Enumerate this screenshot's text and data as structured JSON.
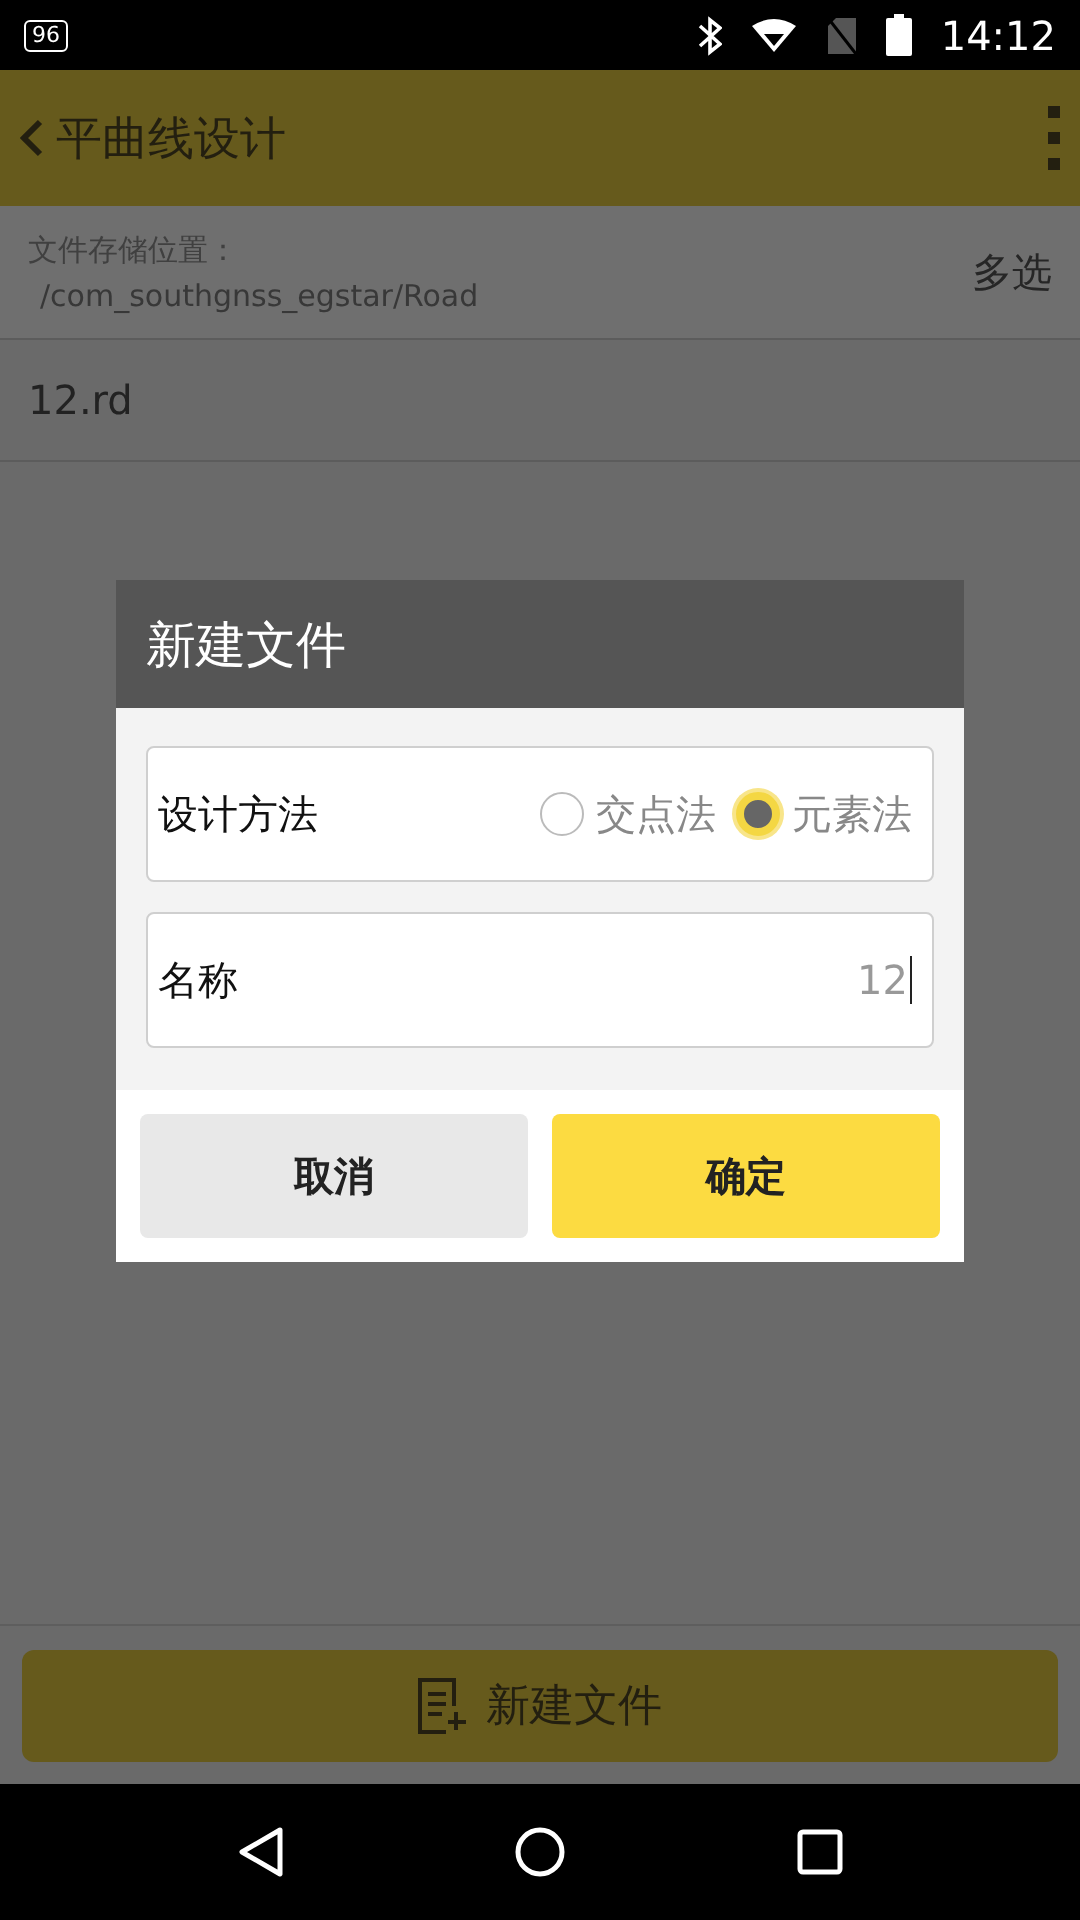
{
  "status_bar": {
    "badge": "96",
    "time": "14:12"
  },
  "app_bar": {
    "title": "平曲线设计"
  },
  "location": {
    "label": "文件存储位置：",
    "path": "/com_southgnss_egstar/Road",
    "action": "多选"
  },
  "files": [
    {
      "name": "12.rd"
    }
  ],
  "dialog": {
    "title": "新建文件",
    "method": {
      "label": "设计方法",
      "options": [
        {
          "label": "交点法",
          "selected": false
        },
        {
          "label": "元素法",
          "selected": true
        }
      ]
    },
    "name_field": {
      "label": "名称",
      "value": "12"
    },
    "buttons": [
      {
        "label": "取消",
        "kind": "secondary"
      },
      {
        "label": "确定",
        "kind": "primary"
      }
    ]
  },
  "bottom_button": {
    "label": "新建文件"
  }
}
